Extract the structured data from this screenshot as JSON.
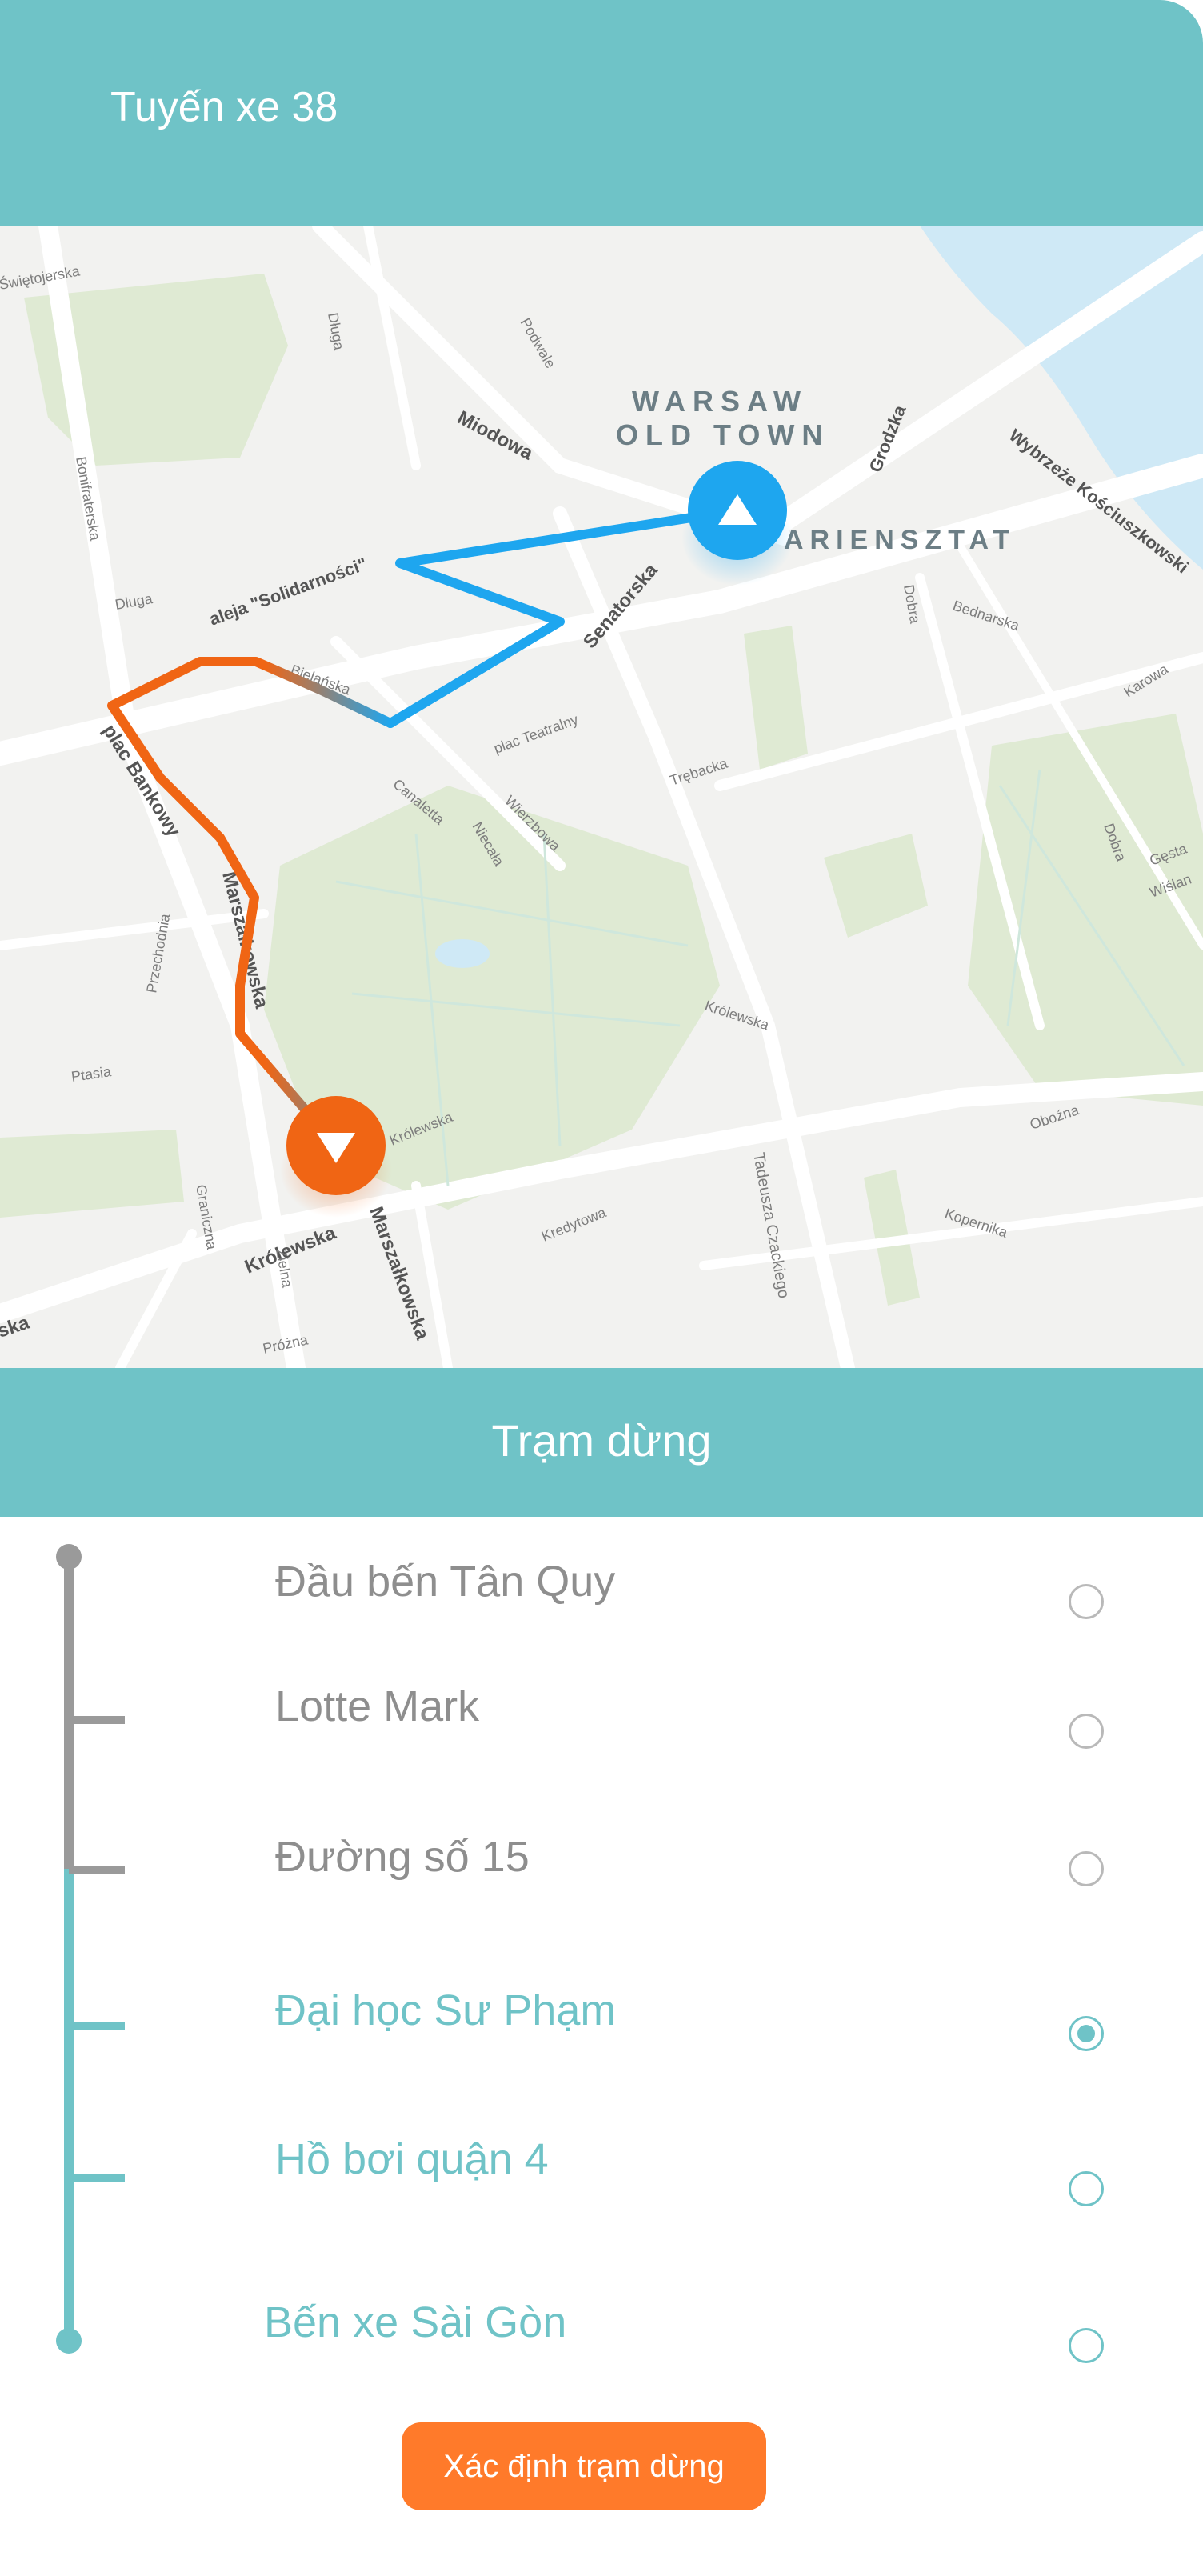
{
  "header": {
    "title": "Tuyến xe 38"
  },
  "map": {
    "labels": {
      "old_town_1": "WARSAW",
      "old_town_2": "OLD TOWN",
      "mariensztat": "ARIENSZTAT",
      "miodowa": "Miodowa",
      "solidarnosci": "aleja \"Solidarności\"",
      "senatorska": "Senatorska",
      "plac_bankowy": "plac Bankowy",
      "marszalkowska_1": "Marszałkowska",
      "marszalkowska_2": "Marszałkowska",
      "krolewska_1": "Królewska",
      "krolewska_2": "Królewska",
      "wybrzeze": "Wybrzeże Kościuszkowski",
      "grodzka": "Grodzka",
      "bielanska": "Bielańska",
      "plac_teatralny": "plac Teatralny",
      "trebacka": "Trębacka",
      "bednarska": "Bednarska",
      "karowa": "Karowa",
      "tadeusza": "Tadeusza Czackiego",
      "kopernika": "Kopernika",
      "kredytowa": "Kredytowa",
      "obozna": "Oboźna",
      "dluga_1": "Długa",
      "dluga_2": "Długa",
      "podwale": "Podwale",
      "swietojerska": "Świętojerska",
      "przechodnia": "Przechodnia",
      "ptasia": "Ptasia",
      "zielna": "Zielna",
      "prozna": "Próżna",
      "graniczna": "Graniczna",
      "wierzbowa": "Wierzbowa",
      "niecala": "Niecała",
      "canaletta": "Canaletta",
      "krolewska_3": "Królewska",
      "dobra": "Dobra",
      "gesta": "Gęsta",
      "wislan": "Wiślan",
      "bonifraterska": "Bonifraterska",
      "gdanska": "Dobra",
      "ska": "ska"
    },
    "colors": {
      "route_start": "#1ea6ef",
      "route_end": "#f06514"
    }
  },
  "stops_header": {
    "title": "Trạm dừng"
  },
  "stops": [
    {
      "name": "Đầu bến Tân Quy",
      "selected": false
    },
    {
      "name": "Lotte Mark",
      "selected": false
    },
    {
      "name": "Đường số 15",
      "selected": false
    },
    {
      "name": "Đại học Sư Phạm",
      "selected": true
    },
    {
      "name": "Hồ bơi quận 4",
      "selected": false
    },
    {
      "name": "Bến xe Sài Gòn",
      "selected": false
    }
  ],
  "action": {
    "label": "Xác định trạm dừng"
  },
  "theme": {
    "primary": "#6fc3c7",
    "accent": "#ff7a2a",
    "inactive": "#8e8e8e"
  }
}
